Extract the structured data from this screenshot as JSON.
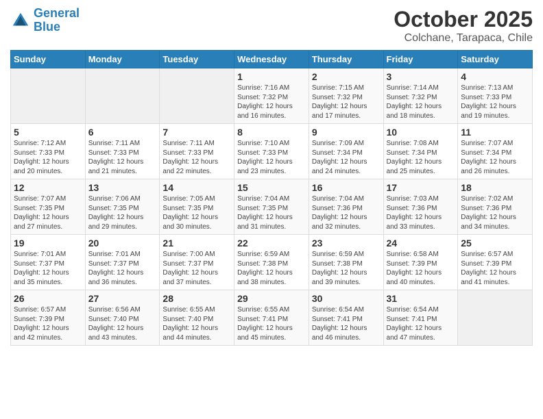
{
  "header": {
    "logo_line1": "General",
    "logo_line2": "Blue",
    "month": "October 2025",
    "location": "Colchane, Tarapaca, Chile"
  },
  "weekdays": [
    "Sunday",
    "Monday",
    "Tuesday",
    "Wednesday",
    "Thursday",
    "Friday",
    "Saturday"
  ],
  "weeks": [
    [
      {
        "day": "",
        "sunrise": "",
        "sunset": "",
        "daylight": ""
      },
      {
        "day": "",
        "sunrise": "",
        "sunset": "",
        "daylight": ""
      },
      {
        "day": "",
        "sunrise": "",
        "sunset": "",
        "daylight": ""
      },
      {
        "day": "1",
        "sunrise": "Sunrise: 7:16 AM",
        "sunset": "Sunset: 7:32 PM",
        "daylight": "Daylight: 12 hours and 16 minutes."
      },
      {
        "day": "2",
        "sunrise": "Sunrise: 7:15 AM",
        "sunset": "Sunset: 7:32 PM",
        "daylight": "Daylight: 12 hours and 17 minutes."
      },
      {
        "day": "3",
        "sunrise": "Sunrise: 7:14 AM",
        "sunset": "Sunset: 7:32 PM",
        "daylight": "Daylight: 12 hours and 18 minutes."
      },
      {
        "day": "4",
        "sunrise": "Sunrise: 7:13 AM",
        "sunset": "Sunset: 7:33 PM",
        "daylight": "Daylight: 12 hours and 19 minutes."
      }
    ],
    [
      {
        "day": "5",
        "sunrise": "Sunrise: 7:12 AM",
        "sunset": "Sunset: 7:33 PM",
        "daylight": "Daylight: 12 hours and 20 minutes."
      },
      {
        "day": "6",
        "sunrise": "Sunrise: 7:11 AM",
        "sunset": "Sunset: 7:33 PM",
        "daylight": "Daylight: 12 hours and 21 minutes."
      },
      {
        "day": "7",
        "sunrise": "Sunrise: 7:11 AM",
        "sunset": "Sunset: 7:33 PM",
        "daylight": "Daylight: 12 hours and 22 minutes."
      },
      {
        "day": "8",
        "sunrise": "Sunrise: 7:10 AM",
        "sunset": "Sunset: 7:33 PM",
        "daylight": "Daylight: 12 hours and 23 minutes."
      },
      {
        "day": "9",
        "sunrise": "Sunrise: 7:09 AM",
        "sunset": "Sunset: 7:34 PM",
        "daylight": "Daylight: 12 hours and 24 minutes."
      },
      {
        "day": "10",
        "sunrise": "Sunrise: 7:08 AM",
        "sunset": "Sunset: 7:34 PM",
        "daylight": "Daylight: 12 hours and 25 minutes."
      },
      {
        "day": "11",
        "sunrise": "Sunrise: 7:07 AM",
        "sunset": "Sunset: 7:34 PM",
        "daylight": "Daylight: 12 hours and 26 minutes."
      }
    ],
    [
      {
        "day": "12",
        "sunrise": "Sunrise: 7:07 AM",
        "sunset": "Sunset: 7:35 PM",
        "daylight": "Daylight: 12 hours and 27 minutes."
      },
      {
        "day": "13",
        "sunrise": "Sunrise: 7:06 AM",
        "sunset": "Sunset: 7:35 PM",
        "daylight": "Daylight: 12 hours and 29 minutes."
      },
      {
        "day": "14",
        "sunrise": "Sunrise: 7:05 AM",
        "sunset": "Sunset: 7:35 PM",
        "daylight": "Daylight: 12 hours and 30 minutes."
      },
      {
        "day": "15",
        "sunrise": "Sunrise: 7:04 AM",
        "sunset": "Sunset: 7:35 PM",
        "daylight": "Daylight: 12 hours and 31 minutes."
      },
      {
        "day": "16",
        "sunrise": "Sunrise: 7:04 AM",
        "sunset": "Sunset: 7:36 PM",
        "daylight": "Daylight: 12 hours and 32 minutes."
      },
      {
        "day": "17",
        "sunrise": "Sunrise: 7:03 AM",
        "sunset": "Sunset: 7:36 PM",
        "daylight": "Daylight: 12 hours and 33 minutes."
      },
      {
        "day": "18",
        "sunrise": "Sunrise: 7:02 AM",
        "sunset": "Sunset: 7:36 PM",
        "daylight": "Daylight: 12 hours and 34 minutes."
      }
    ],
    [
      {
        "day": "19",
        "sunrise": "Sunrise: 7:01 AM",
        "sunset": "Sunset: 7:37 PM",
        "daylight": "Daylight: 12 hours and 35 minutes."
      },
      {
        "day": "20",
        "sunrise": "Sunrise: 7:01 AM",
        "sunset": "Sunset: 7:37 PM",
        "daylight": "Daylight: 12 hours and 36 minutes."
      },
      {
        "day": "21",
        "sunrise": "Sunrise: 7:00 AM",
        "sunset": "Sunset: 7:37 PM",
        "daylight": "Daylight: 12 hours and 37 minutes."
      },
      {
        "day": "22",
        "sunrise": "Sunrise: 6:59 AM",
        "sunset": "Sunset: 7:38 PM",
        "daylight": "Daylight: 12 hours and 38 minutes."
      },
      {
        "day": "23",
        "sunrise": "Sunrise: 6:59 AM",
        "sunset": "Sunset: 7:38 PM",
        "daylight": "Daylight: 12 hours and 39 minutes."
      },
      {
        "day": "24",
        "sunrise": "Sunrise: 6:58 AM",
        "sunset": "Sunset: 7:39 PM",
        "daylight": "Daylight: 12 hours and 40 minutes."
      },
      {
        "day": "25",
        "sunrise": "Sunrise: 6:57 AM",
        "sunset": "Sunset: 7:39 PM",
        "daylight": "Daylight: 12 hours and 41 minutes."
      }
    ],
    [
      {
        "day": "26",
        "sunrise": "Sunrise: 6:57 AM",
        "sunset": "Sunset: 7:39 PM",
        "daylight": "Daylight: 12 hours and 42 minutes."
      },
      {
        "day": "27",
        "sunrise": "Sunrise: 6:56 AM",
        "sunset": "Sunset: 7:40 PM",
        "daylight": "Daylight: 12 hours and 43 minutes."
      },
      {
        "day": "28",
        "sunrise": "Sunrise: 6:55 AM",
        "sunset": "Sunset: 7:40 PM",
        "daylight": "Daylight: 12 hours and 44 minutes."
      },
      {
        "day": "29",
        "sunrise": "Sunrise: 6:55 AM",
        "sunset": "Sunset: 7:41 PM",
        "daylight": "Daylight: 12 hours and 45 minutes."
      },
      {
        "day": "30",
        "sunrise": "Sunrise: 6:54 AM",
        "sunset": "Sunset: 7:41 PM",
        "daylight": "Daylight: 12 hours and 46 minutes."
      },
      {
        "day": "31",
        "sunrise": "Sunrise: 6:54 AM",
        "sunset": "Sunset: 7:41 PM",
        "daylight": "Daylight: 12 hours and 47 minutes."
      },
      {
        "day": "",
        "sunrise": "",
        "sunset": "",
        "daylight": ""
      }
    ]
  ]
}
